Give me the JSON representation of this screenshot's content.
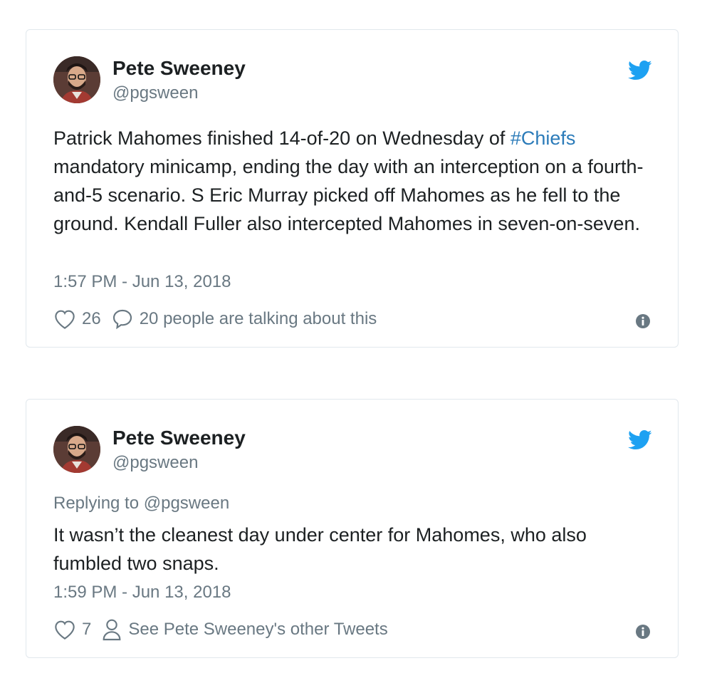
{
  "tweets": [
    {
      "author_name": "Pete Sweeney",
      "author_handle": "@pgsween",
      "text_before": "Patrick Mahomes finished 14-of-20 on Wednesday of ",
      "hashtag": "#Chiefs",
      "text_after": " mandatory minicamp, ending the day with an interception on a fourth-and-5 scenario. S Eric Murray picked off Mahomes as he fell to the ground. Kendall Fuller also intercepted Mahomes in seven-on-seven.",
      "timestamp": "1:57 PM - Jun 13, 2018",
      "likes": "26",
      "secondary_action": "20 people are talking about this",
      "secondary_icon": "speech-bubble-icon"
    },
    {
      "author_name": "Pete Sweeney",
      "author_handle": "@pgsween",
      "replying_to": "Replying to @pgsween",
      "text": "It wasn’t the cleanest day under center for Mahomes, who also fumbled two snaps.",
      "timestamp": "1:59 PM - Jun 13, 2018",
      "likes": "7",
      "secondary_action": "See Pete Sweeney's other Tweets",
      "secondary_icon": "person-icon"
    }
  ],
  "colors": {
    "twitter_blue": "#1da1f2",
    "link_blue": "#2b7bb9",
    "muted_text": "#697882",
    "border": "#e1e8ed"
  }
}
